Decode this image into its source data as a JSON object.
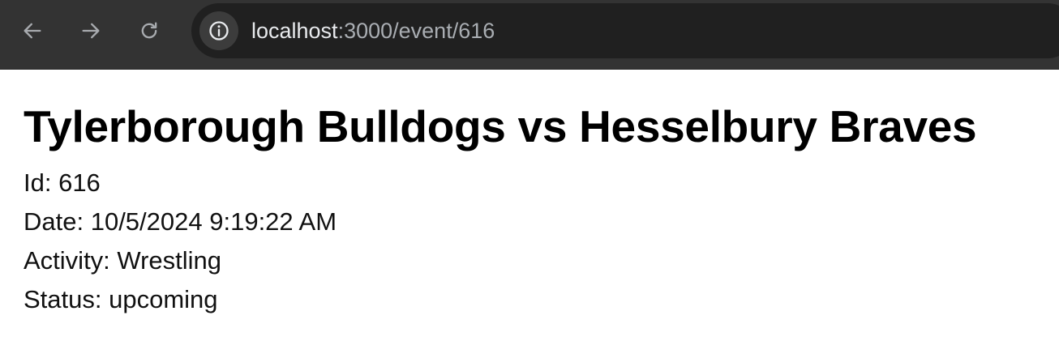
{
  "browser": {
    "url_host": "localhost",
    "url_rest": ":3000/event/616",
    "icons": {
      "back": "arrow-left",
      "forward": "arrow-right",
      "reload": "reload",
      "site_info": "info-circle"
    }
  },
  "event": {
    "title": "Tylerborough Bulldogs vs Hesselbury Braves",
    "id_line": "Id: 616",
    "date_line": "Date: 10/5/2024 9:19:22 AM",
    "activity_line": "Activity: Wrestling",
    "status_line": "Status: upcoming"
  },
  "colors": {
    "toolbar_bg": "#333333",
    "omnibox_bg": "#202020",
    "url_host": "#e8eaed",
    "url_rest": "#a9adb2",
    "page_bg": "#ffffff",
    "text": "#000000"
  }
}
